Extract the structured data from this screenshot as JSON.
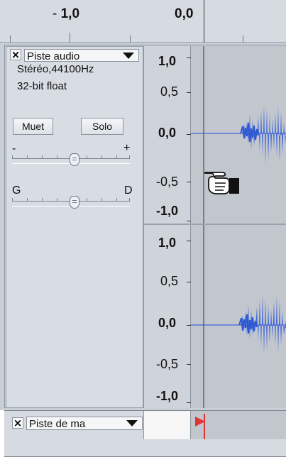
{
  "ruler": {
    "left_label_prefix": "- ",
    "left_label_value": "1,0",
    "center_label_value": "0,0"
  },
  "tracks": [
    {
      "name": "Piste audio",
      "info_line_1": "Stéréo,44100Hz",
      "info_line_2": "32-bit float",
      "mute_label": "Muet",
      "solo_label": "Solo",
      "gain_slider": {
        "left_label": "-",
        "right_label": "+",
        "value": 0.5
      },
      "pan_slider": {
        "left_label": "G",
        "right_label": "D",
        "value": 0.5
      },
      "channels": [
        {
          "scale_labels": [
            "1,0",
            "0,5",
            "0,0",
            "-0,5",
            "-1,0"
          ]
        },
        {
          "scale_labels": [
            "1,0",
            "0,5",
            "0,0",
            "-0,5",
            "-1,0"
          ]
        }
      ]
    },
    {
      "name": "Piste de ma"
    }
  ],
  "colors": {
    "wave": "#4267d8",
    "wave_light": "#6d8df0",
    "center_line": "#5a74d9",
    "marker": "#e13434"
  },
  "icons": {
    "close": "close-icon",
    "menu": "chevron-down-icon",
    "hand": "hand-pointer-icon",
    "marker": "label-marker-icon"
  }
}
